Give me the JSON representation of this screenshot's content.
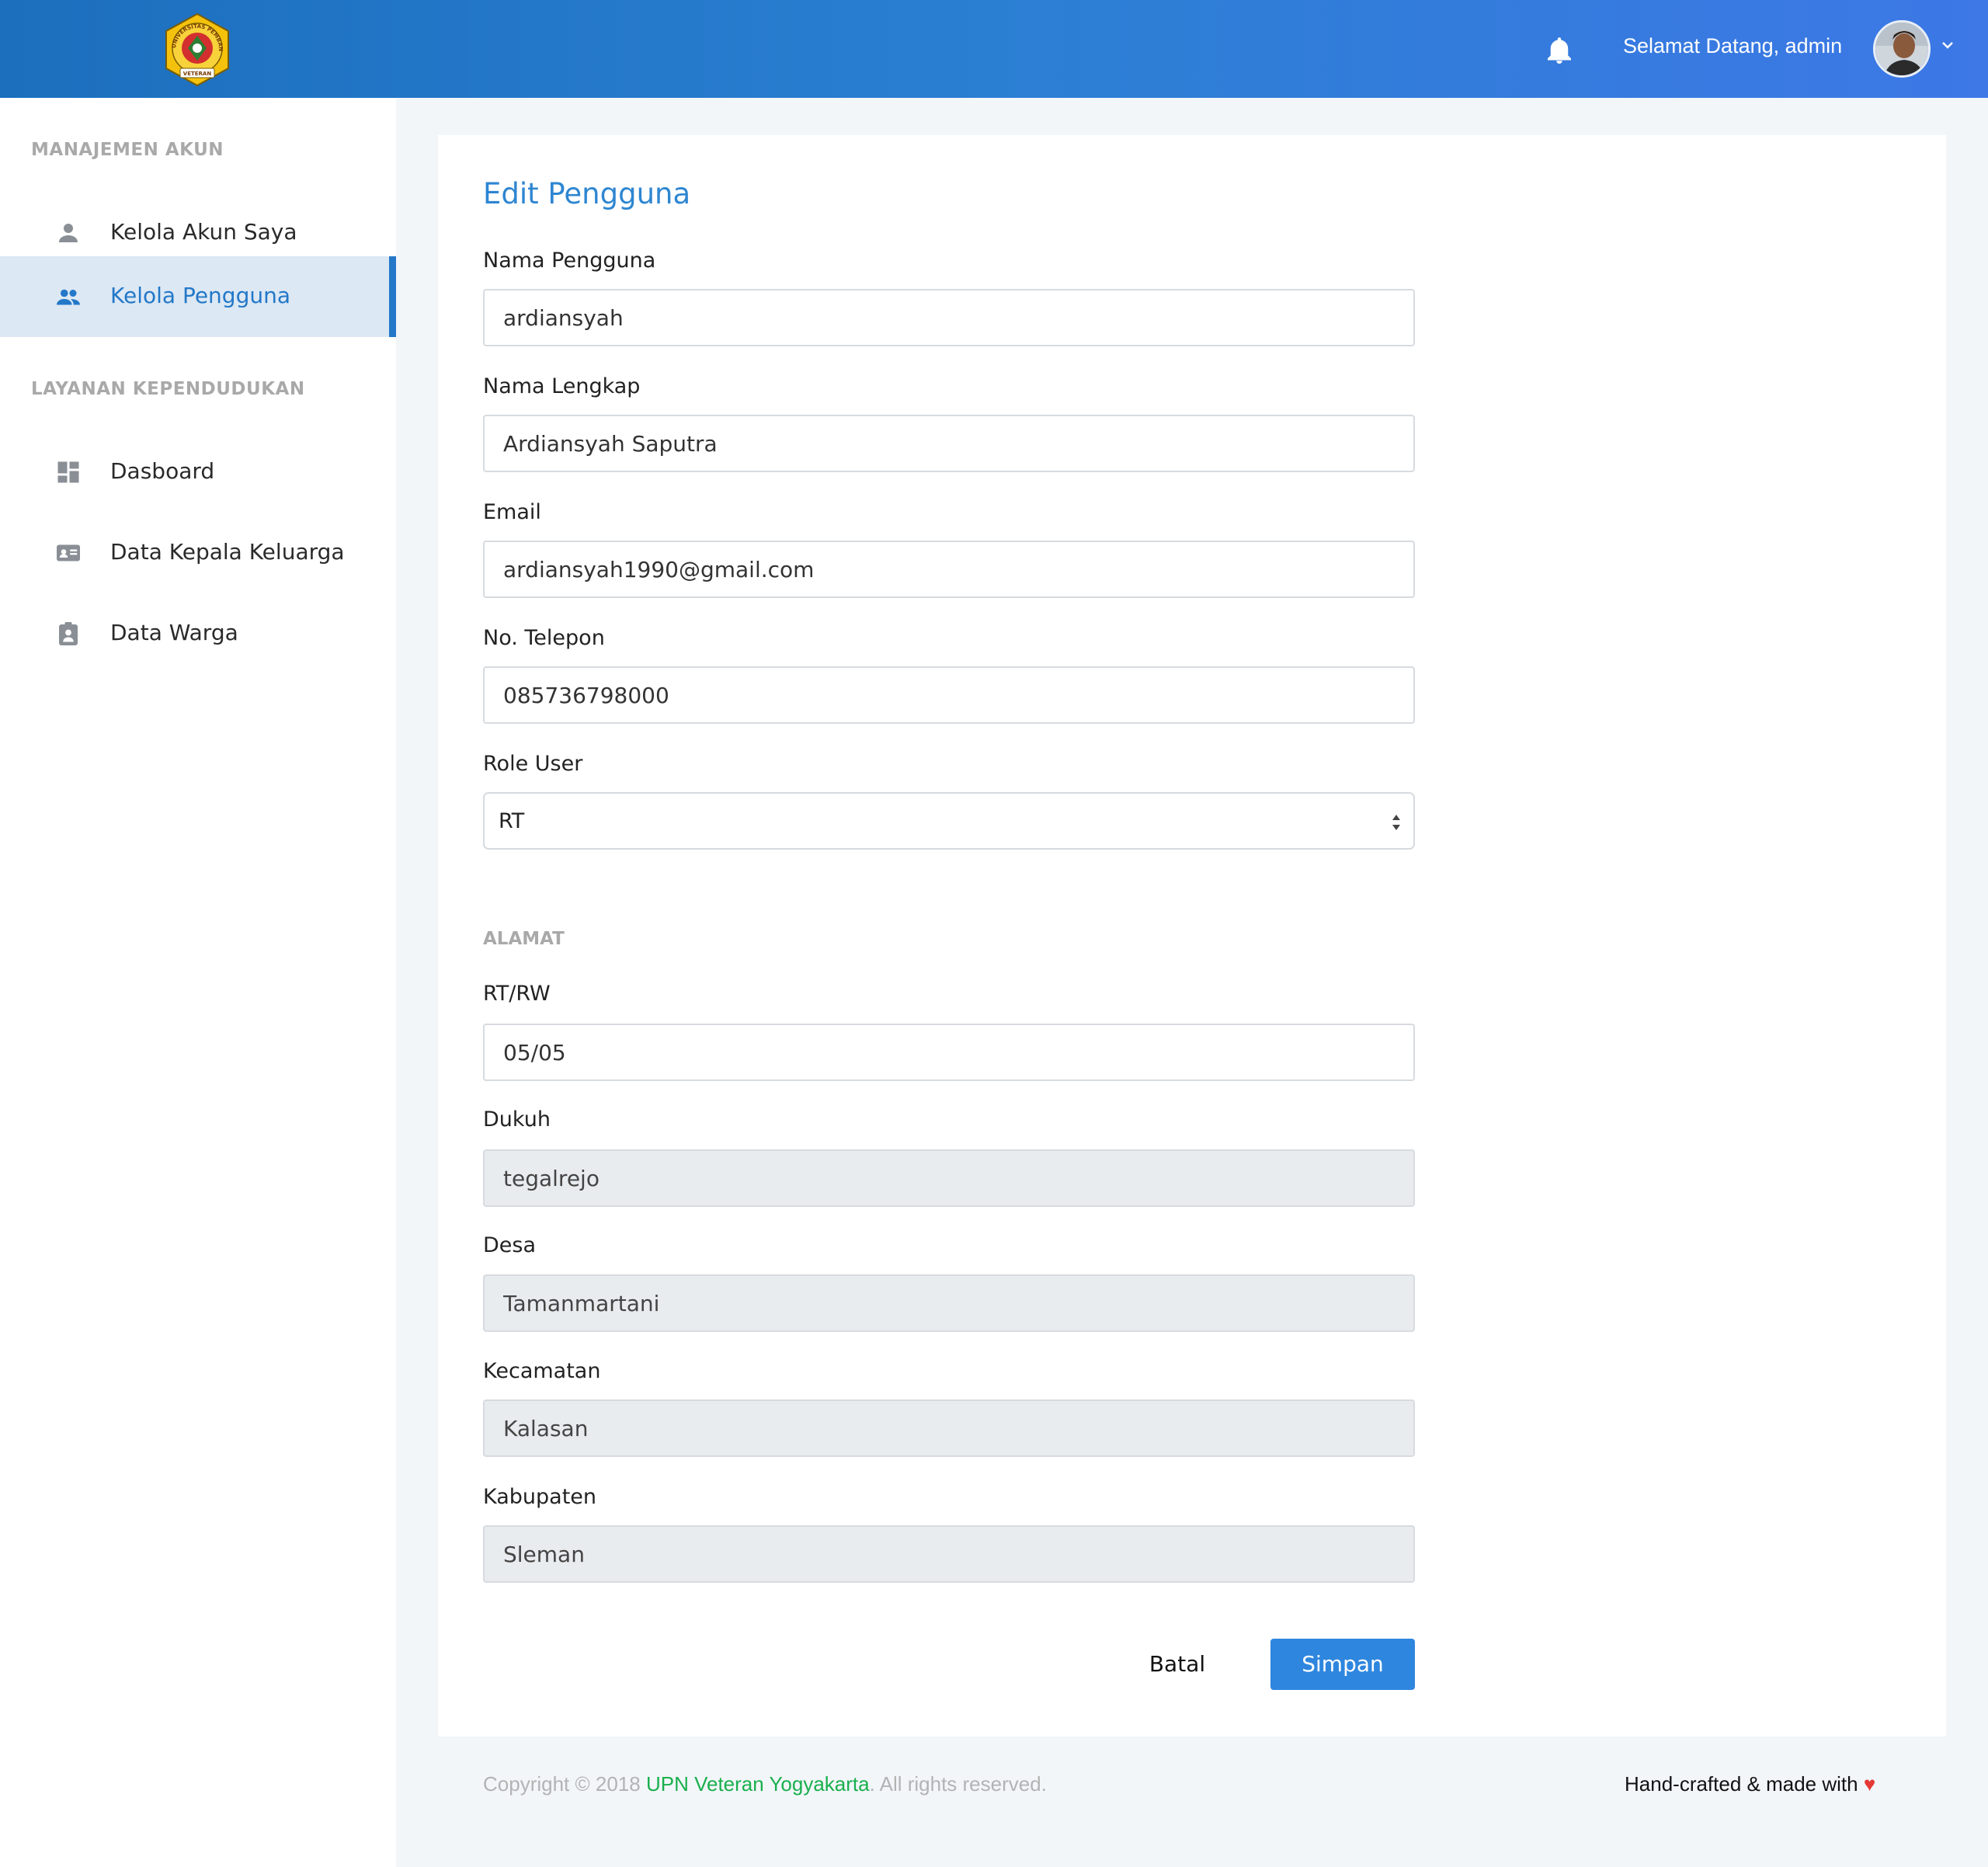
{
  "header": {
    "welcome": "Selamat Datang, admin",
    "logo_ring_text": "UNIVERSITAS PEMBANGUNAN NASIONAL",
    "logo_banner_text": "VETERAN"
  },
  "sidebar": {
    "sections": [
      {
        "title": "MANAJEMEN AKUN",
        "items": [
          {
            "label": "Kelola Akun Saya",
            "icon": "person-icon"
          },
          {
            "label": "Kelola Pengguna",
            "icon": "people-icon",
            "active": true
          }
        ]
      },
      {
        "title": "LAYANAN KEPENDUDUKAN",
        "items": [
          {
            "label": "Dasboard",
            "icon": "dashboard-icon"
          },
          {
            "label": "Data Kepala Keluarga",
            "icon": "id-card-icon"
          },
          {
            "label": "Data Warga",
            "icon": "clipboard-person-icon"
          }
        ]
      }
    ]
  },
  "form": {
    "title": "Edit Pengguna",
    "fields": {
      "username": {
        "label": "Nama Pengguna",
        "value": "ardiansyah"
      },
      "fullname": {
        "label": "Nama Lengkap",
        "value": "Ardiansyah Saputra"
      },
      "email": {
        "label": "Email",
        "value": "ardiansyah1990@gmail.com"
      },
      "phone": {
        "label": "No. Telepon",
        "value": "085736798000"
      },
      "role": {
        "label": "Role User",
        "value": "RT"
      }
    },
    "address_heading": "ALAMAT",
    "address": {
      "rtrw": {
        "label": "RT/RW",
        "value": "05/05"
      },
      "dukuh": {
        "label": "Dukuh",
        "value": "tegalrejo"
      },
      "desa": {
        "label": "Desa",
        "value": "Tamanmartani"
      },
      "kecamatan": {
        "label": "Kecamatan",
        "value": "Kalasan"
      },
      "kabupaten": {
        "label": "Kabupaten",
        "value": "Sleman"
      }
    },
    "buttons": {
      "cancel": "Batal",
      "save": "Simpan"
    }
  },
  "footer": {
    "copyright_prefix": "Copyright © 2018 ",
    "org_link": "UPN Veteran Yogyakarta",
    "copyright_suffix": ". All rights reserved.",
    "credit": "Hand-crafted & made with",
    "heart": "♥"
  },
  "colors": {
    "header_gradient": [
      "#1c6fbd",
      "#3d78e6"
    ],
    "accent": "#2e86de",
    "link_green": "#1aaf4d",
    "heart": "#e53935"
  }
}
